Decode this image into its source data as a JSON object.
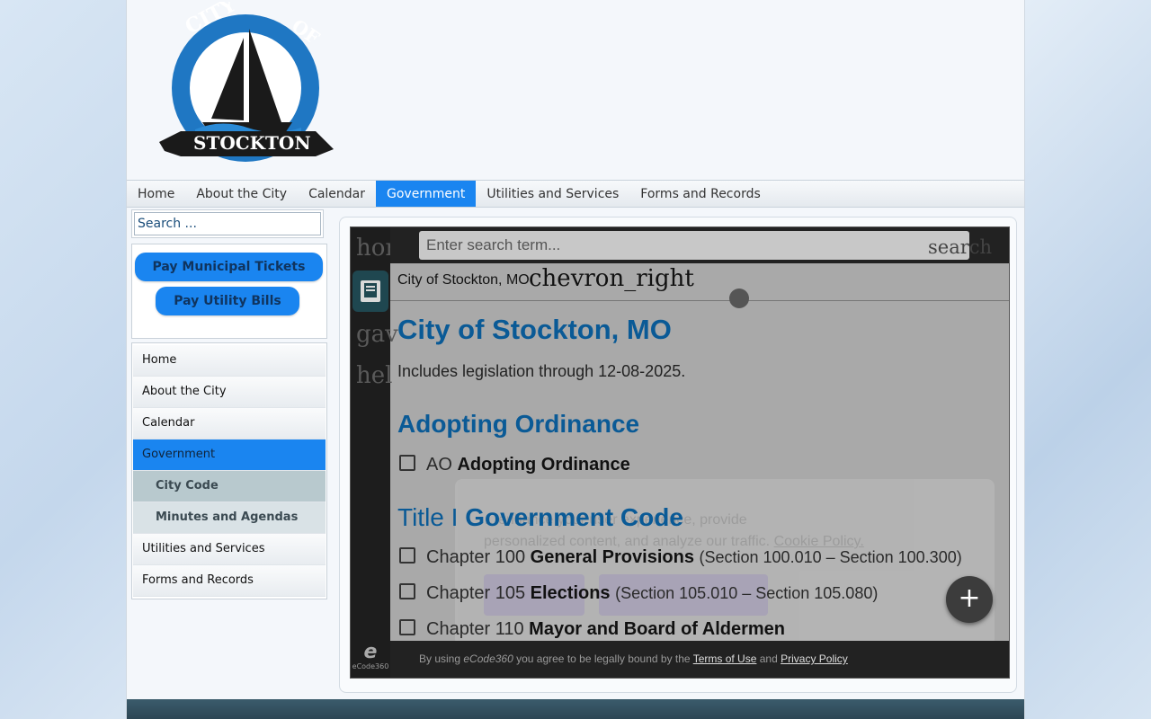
{
  "site": {
    "logo_text_city": "CITY",
    "logo_text_of": "OF",
    "logo_text_name": "STOCKTON"
  },
  "topnav": [
    {
      "label": "Home"
    },
    {
      "label": "About the City"
    },
    {
      "label": "Calendar"
    },
    {
      "label": "Government"
    },
    {
      "label": "Utilities and Services"
    },
    {
      "label": "Forms and Records"
    }
  ],
  "sidebar": {
    "search_placeholder": "Search ...",
    "pay_tickets": "Pay Municipal Tickets",
    "pay_bills": "Pay Utility Bills",
    "menu": [
      {
        "label": "Home"
      },
      {
        "label": "About the City"
      },
      {
        "label": "Calendar"
      },
      {
        "label": "Government"
      },
      {
        "label": "City Code"
      },
      {
        "label": "Minutes and Agendas"
      },
      {
        "label": "Utilities and Services"
      },
      {
        "label": "Forms and Records"
      }
    ]
  },
  "ecode": {
    "search_placeholder": "Enter search term...",
    "search_icon_text": "search",
    "rail_texts": [
      "hor",
      "gav",
      "hel"
    ],
    "breadcrumb": "City of Stockton, MO",
    "chevron_text": "chevron_right",
    "title": "City of Stockton, MO",
    "subtitle": "Includes legislation through 12-08-2025.",
    "section1": "Adopting Ordinance",
    "row_ao_prefix": "AO",
    "row_ao_name": "Adopting Ordinance",
    "section2_prefix": "Title I",
    "section2_name": "Government Code",
    "chapters": [
      {
        "num": "Chapter 100",
        "name": "General Provisions",
        "range": "(Section 100.010 – Section 100.300)"
      },
      {
        "num": "Chapter 105",
        "name": "Elections",
        "range": "(Section 105.010 – Section 105.080)"
      },
      {
        "num": "Chapter 110",
        "name": "Mayor and Board of Aldermen",
        "range": ""
      }
    ],
    "cookie_line1": "…enhance your user experience, provide",
    "cookie_line2": "personalized content, and analyze our traffic.",
    "cookie_link": "Cookie Policy.",
    "footer_prefix": "By using",
    "footer_brand": "eCode360",
    "footer_mid": "you agree to be legally bound by the",
    "footer_terms": "Terms of Use",
    "footer_and": "and",
    "footer_privacy": "Privacy Policy",
    "logo_label": "eCode360",
    "fab_label": "+"
  }
}
